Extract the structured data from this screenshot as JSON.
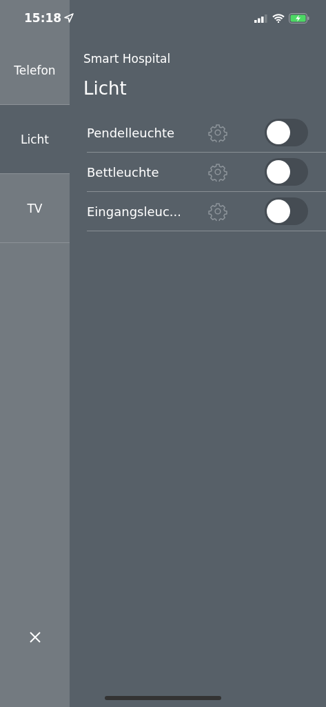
{
  "status_bar": {
    "time": "15:18",
    "battery_charging": true
  },
  "sidebar": {
    "items": [
      {
        "label": "Telefon",
        "selected": false
      },
      {
        "label": "Licht",
        "selected": true
      },
      {
        "label": "TV",
        "selected": false
      }
    ]
  },
  "header": {
    "subtitle": "Smart Hospital",
    "title": "Licht"
  },
  "lights": [
    {
      "name": "Pendelleuchte",
      "on": false
    },
    {
      "name": "Bettleuchte",
      "on": false
    },
    {
      "name": "Eingangsleuc...",
      "on": false
    }
  ]
}
